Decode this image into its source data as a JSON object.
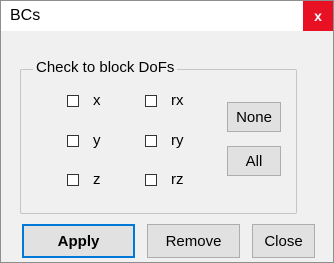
{
  "window": {
    "title": "BCs",
    "close_glyph": "x"
  },
  "group": {
    "label": "Check to block DoFs",
    "checkboxes": [
      {
        "label": "x",
        "checked": false
      },
      {
        "label": "y",
        "checked": false
      },
      {
        "label": "z",
        "checked": false
      },
      {
        "label": "rx",
        "checked": false
      },
      {
        "label": "ry",
        "checked": false
      },
      {
        "label": "rz",
        "checked": false
      }
    ],
    "none_label": "None",
    "all_label": "All"
  },
  "footer": {
    "apply_label": "Apply",
    "remove_label": "Remove",
    "close_label": "Close"
  },
  "colors": {
    "close_button": "#e81123",
    "default_button_border": "#0078d7"
  },
  "icons": {
    "close": "close-icon"
  }
}
